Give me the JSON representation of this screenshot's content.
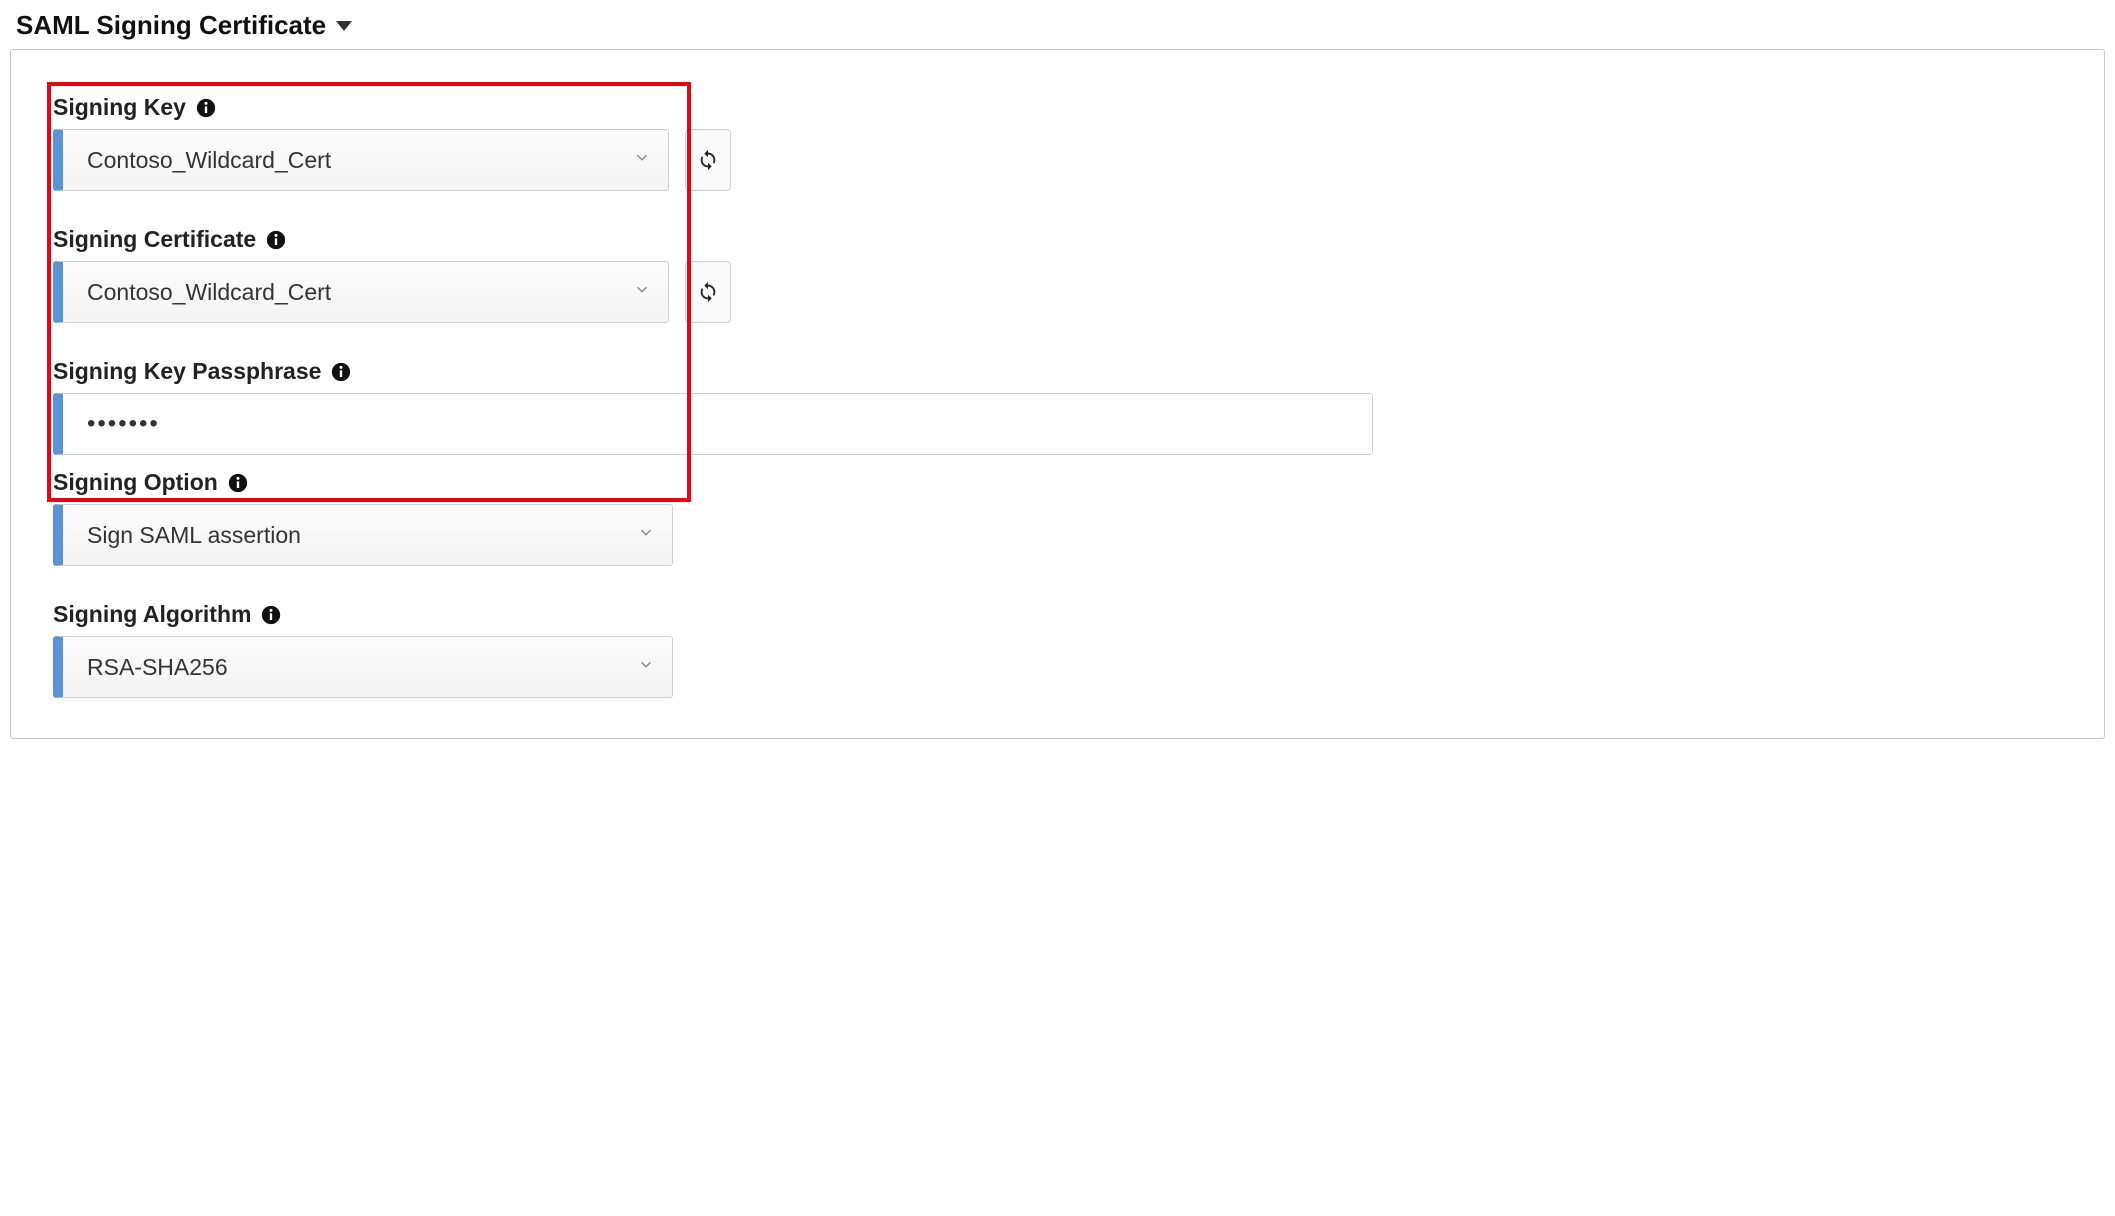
{
  "section": {
    "title": "SAML Signing Certificate"
  },
  "fields": {
    "signing_key": {
      "label": "Signing Key",
      "value": "Contoso_Wildcard_Cert"
    },
    "signing_certificate": {
      "label": "Signing Certificate",
      "value": "Contoso_Wildcard_Cert"
    },
    "signing_key_passphrase": {
      "label": "Signing Key Passphrase",
      "value": "•••••••"
    },
    "signing_option": {
      "label": "Signing Option",
      "value": "Sign SAML assertion"
    },
    "signing_algorithm": {
      "label": "Signing Algorithm",
      "value": "RSA-SHA256"
    }
  }
}
